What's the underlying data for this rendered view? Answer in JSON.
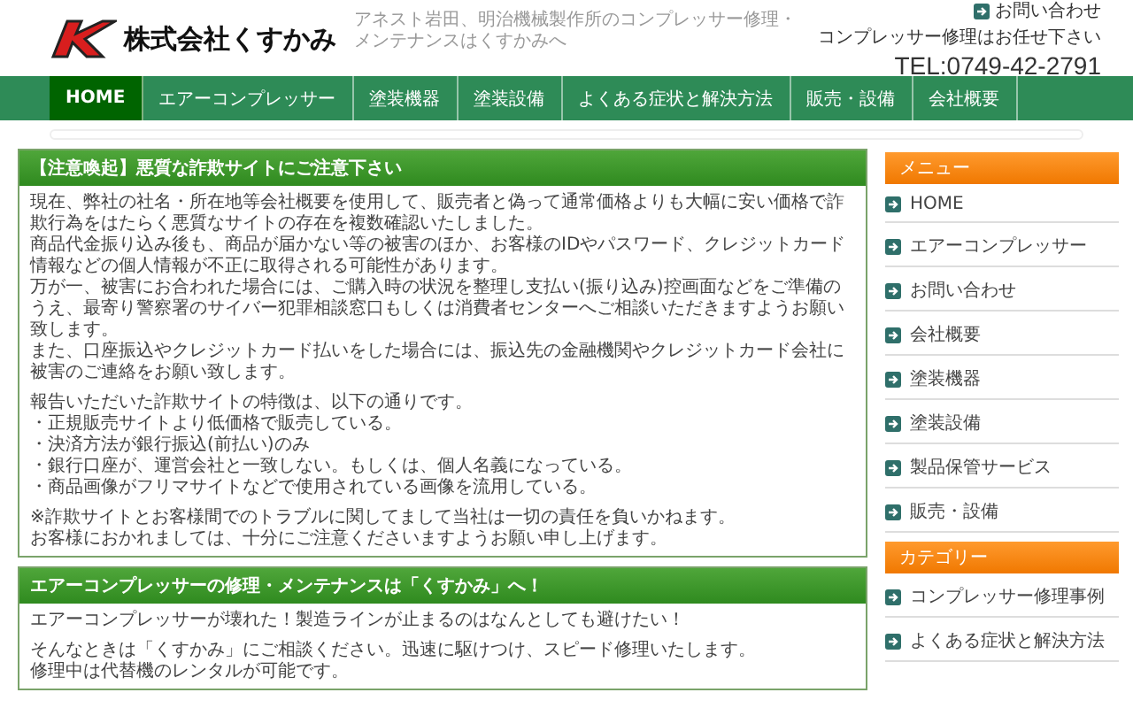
{
  "header": {
    "company_name": "株式会社くすかみ",
    "tagline": "アネスト岩田、明治機械製作所のコンプレッサー修理・メンテナンスはくすかみへ",
    "contact_link": "お問い合わせ",
    "catchphrase": "コンプレッサー修理はお任せ下さい",
    "phone": "TEL:0749-42-2791"
  },
  "nav": [
    {
      "label": "HOME",
      "selected": true
    },
    {
      "label": "エアーコンプレッサー",
      "selected": false
    },
    {
      "label": "塗装機器",
      "selected": false
    },
    {
      "label": "塗装設備",
      "selected": false
    },
    {
      "label": "よくある症状と解決方法",
      "selected": false
    },
    {
      "label": "販売・設備",
      "selected": false
    },
    {
      "label": "会社概要",
      "selected": false
    }
  ],
  "articles": [
    {
      "title": "【注意喚起】悪質な詐欺サイトにご注意下さい",
      "paragraphs": [
        [
          "現在、弊社の社名・所在地等会社概要を使用して、販売者と偽って通常価格よりも大幅に安い価格で詐欺行為をはたらく悪質なサイトの存在を複数確認いたしました。",
          "商品代金振り込み後も、商品が届かない等の被害のほか、お客様のIDやパスワード、クレジットカード情報などの個人情報が不正に取得される可能性があります。",
          "万が一、被害にお合われた場合には、ご購入時の状況を整理し支払い(振り込み)控画面などをご準備のうえ、最寄り警察署のサイバー犯罪相談窓口もしくは消費者センターへご相談いただきますようお願い致します。",
          "また、口座振込やクレジットカード払いをした場合には、振込先の金融機関やクレジットカード会社に被害のご連絡をお願い致します。"
        ],
        [
          "報告いただいた詐欺サイトの特徴は、以下の通りです。",
          "・正規販売サイトより低価格で販売している。",
          "・決済方法が銀行振込(前払い)のみ",
          "・銀行口座が、運営会社と一致しない。もしくは、個人名義になっている。",
          "・商品画像がフリマサイトなどで使用されている画像を流用している。"
        ],
        [
          "※詐欺サイトとお客様間でのトラブルに関してまして当社は一切の責任を負いかねます。",
          "お客様におかれましては、十分にご注意くださいますようお願い申し上げます。"
        ]
      ]
    },
    {
      "title": "エアーコンプレッサーの修理・メンテナンスは「くすかみ」へ！",
      "paragraphs": [
        [
          "エアーコンプレッサーが壊れた！製造ラインが止まるのはなんとしても避けたい！"
        ],
        [
          "そんなときは「くすかみ」にご相談ください。迅速に駆けつけ、スピード修理いたします。",
          "修理中は代替機のレンタルが可能です。"
        ]
      ]
    }
  ],
  "sidebar": [
    {
      "heading": "メニュー",
      "items": [
        "HOME",
        "エアーコンプレッサー",
        "お問い合わせ",
        "会社概要",
        "塗装機器",
        "塗装設備",
        "製品保管サービス",
        "販売・設備"
      ]
    },
    {
      "heading": "カテゴリー",
      "items": [
        "コンプレッサー修理事例",
        "よくある症状と解決方法"
      ]
    }
  ]
}
